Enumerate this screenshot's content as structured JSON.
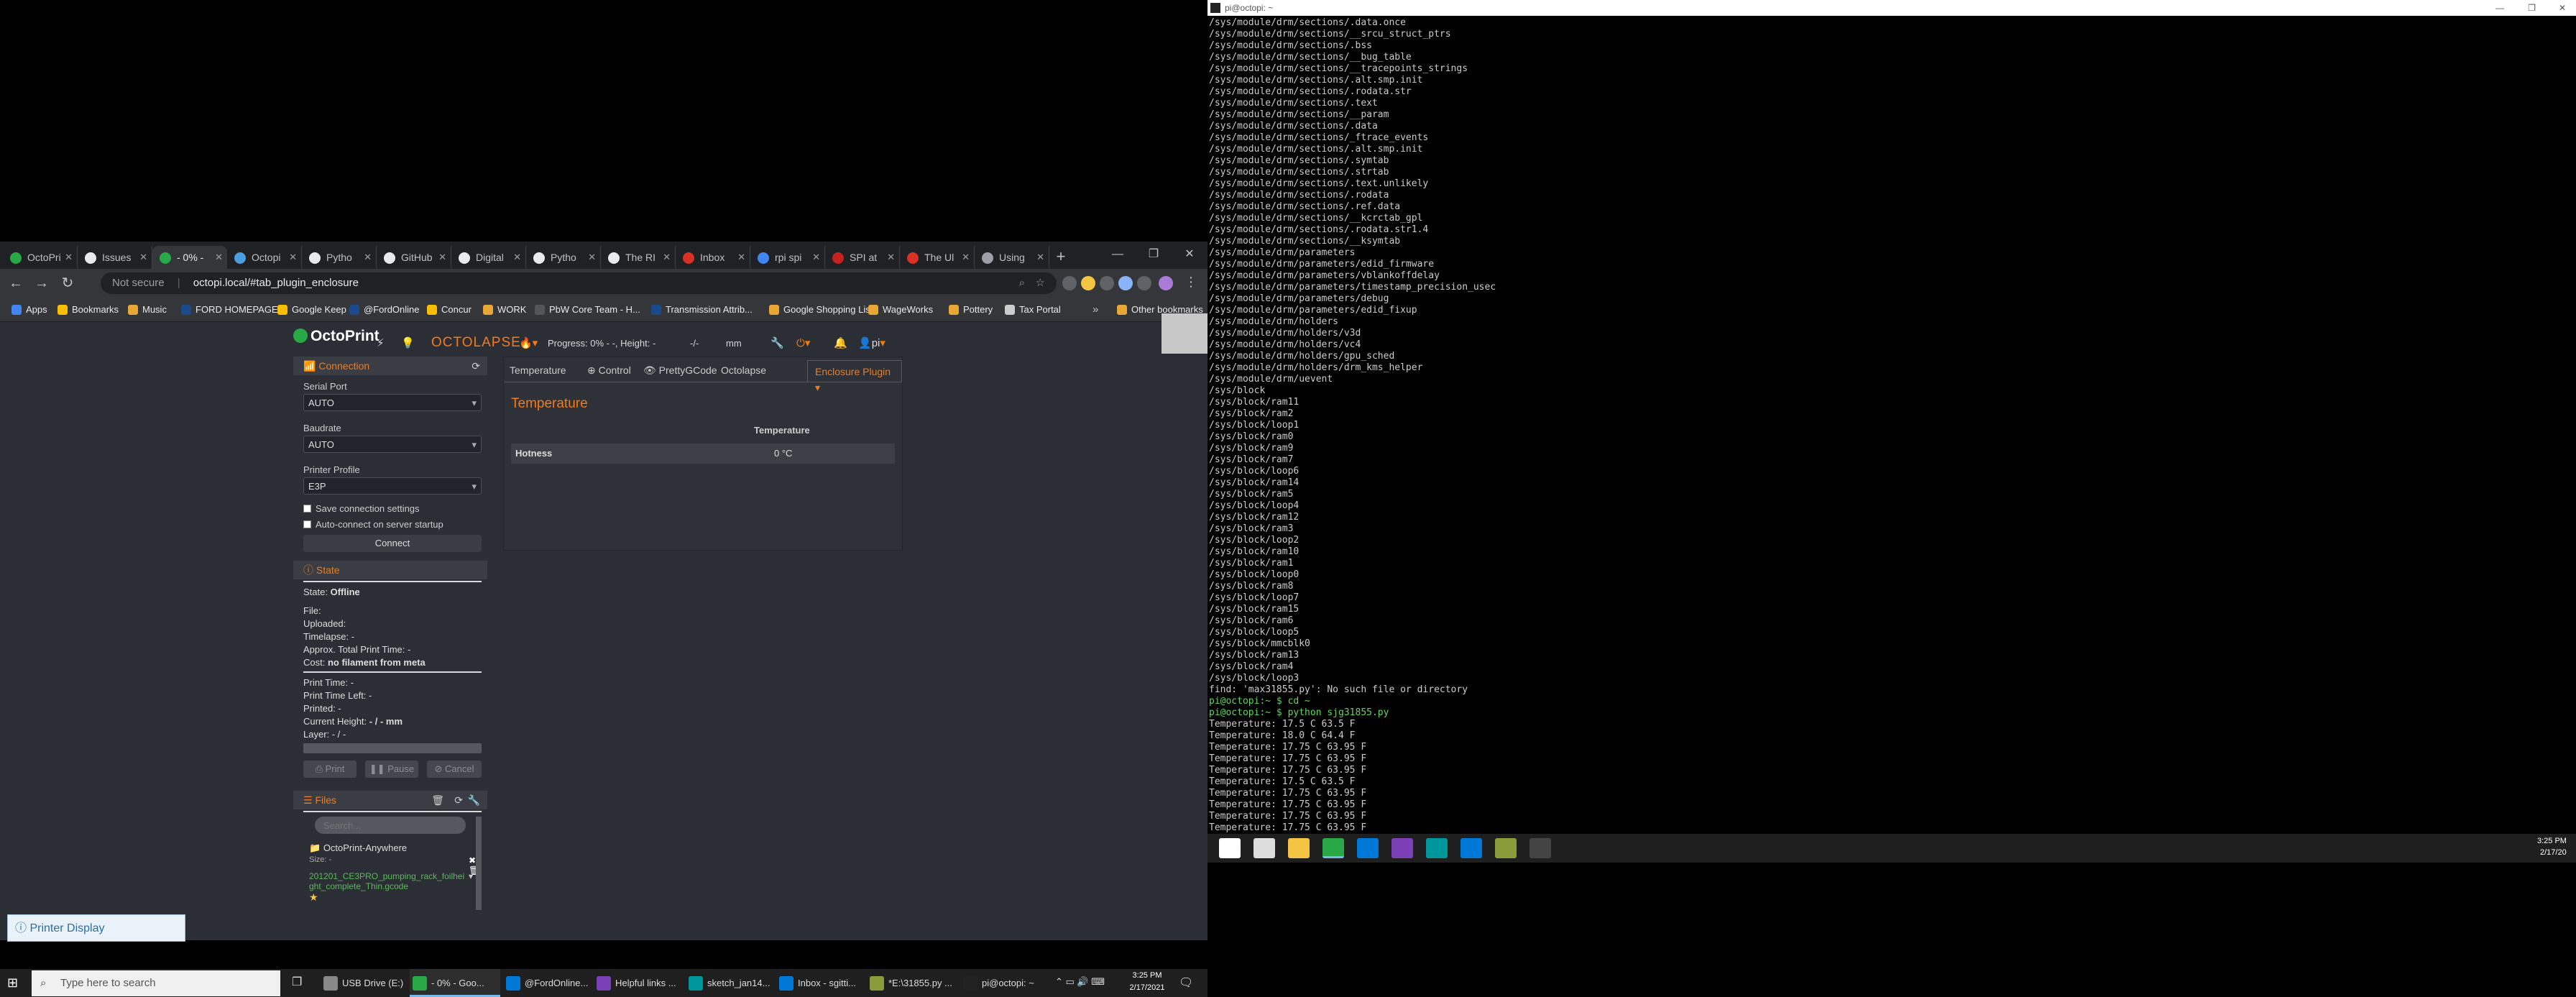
{
  "chrome": {
    "tabs": [
      {
        "label": "OctoPri",
        "color": "#29a847"
      },
      {
        "label": "Issues",
        "color": "#e8eaed"
      },
      {
        "label": "- 0% -",
        "color": "#29a847"
      },
      {
        "label": "Octopi",
        "color": "#4a9de0"
      },
      {
        "label": "Pytho",
        "color": "#e8eaed"
      },
      {
        "label": "GitHub",
        "color": "#e8eaed"
      },
      {
        "label": "Digital",
        "color": "#e8eaed"
      },
      {
        "label": "Pytho",
        "color": "#e8eaed"
      },
      {
        "label": "The RI",
        "color": "#e8eaed"
      },
      {
        "label": "Inbox",
        "color": "#d93025"
      },
      {
        "label": "rpi spi",
        "color": "#4285f4"
      },
      {
        "label": "SPI at",
        "color": "#c5221f"
      },
      {
        "label": "The Ul",
        "color": "#d93025"
      },
      {
        "label": "Using",
        "color": "#9aa0a6"
      }
    ],
    "new_tab": "+",
    "window_controls": {
      "minimize": "—",
      "restore": "❐",
      "close": "✕"
    },
    "nav": {
      "back": "←",
      "forward": "→",
      "reload": "↻"
    },
    "address": {
      "security": "Not secure",
      "url": "octopi.local/#tab_plugin_enclosure"
    },
    "bookmarks": [
      {
        "label": "Apps",
        "color": "#4285f4"
      },
      {
        "label": "Bookmarks",
        "color": "#fbbc04"
      },
      {
        "label": "Music",
        "color": "#e8a735"
      },
      {
        "label": "FORD HOMEPAGE",
        "color": "#1a4a8c"
      },
      {
        "label": "Google Keep",
        "color": "#fbbc04"
      },
      {
        "label": "@FordOnline",
        "color": "#1a4a8c"
      },
      {
        "label": "Concur",
        "color": "#fbbc04"
      },
      {
        "label": "WORK",
        "color": "#e8a735"
      },
      {
        "label": "PbW Core Team - H...",
        "color": "#555"
      },
      {
        "label": "Transmission Attrib...",
        "color": "#1a4a8c"
      },
      {
        "label": "Google Shopping List",
        "color": "#e8a735"
      },
      {
        "label": "WageWorks",
        "color": "#e8a735"
      },
      {
        "label": "Pottery",
        "color": "#e8a735"
      },
      {
        "label": "Tax Portal",
        "color": "#ccc"
      }
    ],
    "bookmarks_more": "»",
    "other_bookmarks": "Other bookmarks"
  },
  "octoprint": {
    "brand": "OctoPrint",
    "navbar": {
      "octolapse": "OCTOLAPSE",
      "progress": "Progress: 0% - -, Height: -",
      "progress_tail": "-/-",
      "progress_unit": "mm",
      "user": "pi"
    },
    "connection": {
      "title": "Connection",
      "serial_port_label": "Serial Port",
      "serial_port_value": "AUTO",
      "baudrate_label": "Baudrate",
      "baudrate_value": "AUTO",
      "profile_label": "Printer Profile",
      "profile_value": "E3P",
      "save_label": "Save connection settings",
      "autoconnect_label": "Auto-connect on server startup",
      "connect_button": "Connect"
    },
    "state": {
      "title": "State",
      "state_label": "State:",
      "state_value": "Offline",
      "file": "File:",
      "uploaded": "Uploaded:",
      "timelapse": "Timelapse: -",
      "approx": "Approx. Total Print Time: -",
      "cost_label": "Cost:",
      "cost_value": "no filament from meta",
      "print_time": "Print Time: -",
      "print_time_left": "Print Time Left: -",
      "printed": "Printed: -",
      "current_height_label": "Current Height:",
      "current_height_value": "- / - mm",
      "layer": "Layer: - / -",
      "print_button": "Print",
      "pause_button": "Pause",
      "cancel_button": "Cancel"
    },
    "files": {
      "title": "Files",
      "search_placeholder": "Search...",
      "folder": "OctoPrint-Anywhere",
      "size_label": "Size: -",
      "file_name": "201201_CE3PRO_pumping_rack_foilheight_complete_Thin.gcode"
    },
    "tabs": [
      "Temperature",
      "Control",
      "PrettyGCode",
      "Octolapse",
      "Enclosure Plugin"
    ],
    "enclosure": {
      "title": "Temperature",
      "col_header": "Temperature",
      "row_name": "Hotness",
      "row_value": "0 °C"
    },
    "printer_display": "Printer Display"
  },
  "taskbar_left": {
    "search_placeholder": "Type here to search",
    "items": [
      {
        "label": "USB Drive (E:)",
        "color": "#888"
      },
      {
        "label": "- 0% - Goo...",
        "color": "#29a847"
      },
      {
        "label": "@FordOnline...",
        "color": "#0078d7"
      },
      {
        "label": "Helpful links ...",
        "color": "#7b3fb6"
      },
      {
        "label": "sketch_jan14...",
        "color": "#00979c"
      },
      {
        "label": "Inbox - sgitti...",
        "color": "#0078d7"
      },
      {
        "label": "*E:\\31855.py ...",
        "color": "#8a9c3a"
      },
      {
        "label": "pi@octopi: ~",
        "color": "#222"
      }
    ],
    "time": "3:25 PM",
    "date": "2/17/2021"
  },
  "terminal": {
    "title": "pi@octopi: ~",
    "lines": [
      "/sys/module/drm/sections/.data.once",
      "/sys/module/drm/sections/__srcu_struct_ptrs",
      "/sys/module/drm/sections/.bss",
      "/sys/module/drm/sections/__bug_table",
      "/sys/module/drm/sections/__tracepoints_strings",
      "/sys/module/drm/sections/.alt.smp.init",
      "/sys/module/drm/sections/.rodata.str",
      "/sys/module/drm/sections/.text",
      "/sys/module/drm/sections/__param",
      "/sys/module/drm/sections/.data",
      "/sys/module/drm/sections/_ftrace_events",
      "/sys/module/drm/sections/.alt.smp.init",
      "/sys/module/drm/sections/.symtab",
      "/sys/module/drm/sections/.strtab",
      "/sys/module/drm/sections/.text.unlikely",
      "/sys/module/drm/sections/.rodata",
      "/sys/module/drm/sections/.ref.data",
      "/sys/module/drm/sections/__kcrctab_gpl",
      "/sys/module/drm/sections/.rodata.str1.4",
      "/sys/module/drm/sections/__ksymtab",
      "/sys/module/drm/parameters",
      "/sys/module/drm/parameters/edid_firmware",
      "/sys/module/drm/parameters/vblankoffdelay",
      "/sys/module/drm/parameters/timestamp_precision_usec",
      "/sys/module/drm/parameters/debug",
      "/sys/module/drm/parameters/edid_fixup",
      "/sys/module/drm/holders",
      "/sys/module/drm/holders/v3d",
      "/sys/module/drm/holders/vc4",
      "/sys/module/drm/holders/gpu_sched",
      "/sys/module/drm/holders/drm_kms_helper",
      "/sys/module/drm/uevent",
      "/sys/block",
      "/sys/block/ram11",
      "/sys/block/ram2",
      "/sys/block/loop1",
      "/sys/block/ram0",
      "/sys/block/ram9",
      "/sys/block/ram7",
      "/sys/block/loop6",
      "/sys/block/ram14",
      "/sys/block/ram5",
      "/sys/block/loop4",
      "/sys/block/ram12",
      "/sys/block/ram3",
      "/sys/block/loop2",
      "/sys/block/ram10",
      "/sys/block/ram1",
      "/sys/block/loop0",
      "/sys/block/ram8",
      "/sys/block/loop7",
      "/sys/block/ram15",
      "/sys/block/ram6",
      "/sys/block/loop5",
      "/sys/block/mmcblk0",
      "/sys/block/ram13",
      "/sys/block/ram4",
      "/sys/block/loop3",
      "find: 'max31855.py': No such file or directory",
      "pi@octopi:~ $ cd ~",
      "pi@octopi:~ $ python sjg31855.py",
      "Temperature: 17.5 C 63.5 F",
      "Temperature: 18.0 C 64.4 F",
      "Temperature: 17.75 C 63.95 F",
      "Temperature: 17.75 C 63.95 F",
      "Temperature: 17.75 C 63.95 F",
      "Temperature: 17.5 C 63.5 F",
      "Temperature: 17.75 C 63.95 F",
      "Temperature: 17.75 C 63.95 F",
      "Temperature: 17.75 C 63.95 F",
      "Temperature: 17.75 C 63.95 F",
      "_"
    ]
  },
  "taskbar_right": {
    "time": "3:25 PM",
    "date": "2/17/20",
    "icons": [
      {
        "name": "windows-start",
        "color": "#fff"
      },
      {
        "name": "search",
        "color": "#ddd"
      },
      {
        "name": "explorer",
        "color": "#f4c542"
      },
      {
        "name": "chrome",
        "color": "#29a847"
      },
      {
        "name": "edge",
        "color": "#0078d7"
      },
      {
        "name": "onenote",
        "color": "#7b3fb6"
      },
      {
        "name": "arduino",
        "color": "#00979c"
      },
      {
        "name": "outlook",
        "color": "#0078d7"
      },
      {
        "name": "notepad",
        "color": "#8a9c3a"
      },
      {
        "name": "terminal",
        "color": "#444"
      }
    ]
  }
}
